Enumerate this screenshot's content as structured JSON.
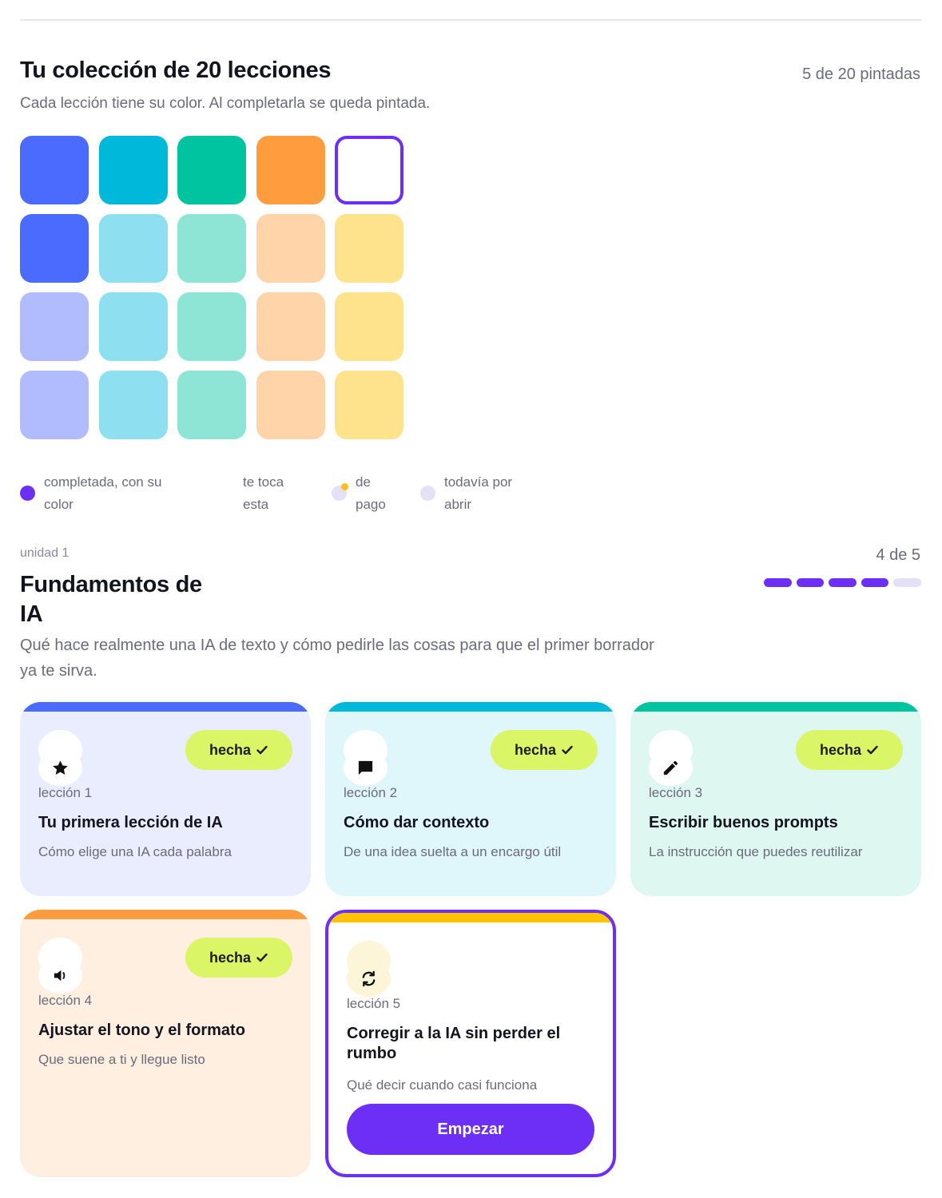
{
  "colors": {
    "accent": "#6d2ff5",
    "done_pill": "#daf566",
    "blue": "#4b6bff",
    "cyan": "#00b8d9",
    "teal": "#00c4a0",
    "orange": "#ff9c3d",
    "yellow": "#ffc300"
  },
  "collection": {
    "title": "Tu colección de 20 lecciones",
    "count": "5 de 20 pintadas",
    "subtitle": "Cada lección tiene su color. Al completarla se queda pintada.",
    "tiles": [
      {
        "state": "done",
        "color": "#4b6bff"
      },
      {
        "state": "done",
        "color": "#00b8d9"
      },
      {
        "state": "done",
        "color": "#00c4a0"
      },
      {
        "state": "done",
        "color": "#ff9c3d"
      },
      {
        "state": "current",
        "color": "#ffffff"
      },
      {
        "state": "done",
        "color": "#4b6bff"
      },
      {
        "state": "locked",
        "color": "#8ee0f0"
      },
      {
        "state": "locked",
        "color": "#8ee5d5"
      },
      {
        "state": "locked",
        "color": "#ffd4a8"
      },
      {
        "state": "locked",
        "color": "#ffe38c"
      },
      {
        "state": "locked",
        "color": "#b1bcff"
      },
      {
        "state": "locked",
        "color": "#8ee0f0"
      },
      {
        "state": "locked",
        "color": "#8ee5d5"
      },
      {
        "state": "locked",
        "color": "#ffd4a8"
      },
      {
        "state": "locked",
        "color": "#ffe38c"
      },
      {
        "state": "locked",
        "color": "#b1bcff"
      },
      {
        "state": "locked",
        "color": "#8ee0f0"
      },
      {
        "state": "locked",
        "color": "#8ee5d5"
      },
      {
        "state": "locked",
        "color": "#ffd4a8"
      },
      {
        "state": "locked",
        "color": "#ffe38c"
      }
    ],
    "legend": [
      {
        "label": "completada, con su color",
        "dot": "#6d2ff5",
        "badge": false
      },
      {
        "label": "te toca esta",
        "dot": "",
        "badge": false
      },
      {
        "label": "de pago",
        "dot": "#e4e0f5",
        "badge": true
      },
      {
        "label": "todavía por abrir",
        "dot": "#e4e0f5",
        "badge": false
      }
    ]
  },
  "unit": {
    "label": "unidad 1",
    "title": "Fundamentos de IA",
    "description": "Qué hace realmente una IA de texto y cómo pedirle las cosas para que el primer borrador ya te sirva.",
    "progress_text": "4 de 5",
    "progress": {
      "done": 4,
      "total": 5
    }
  },
  "lessons": [
    {
      "number": "lección 1",
      "title": "Tu primera lección de IA",
      "description": "Cómo elige una IA cada palabra",
      "status": "hecha",
      "icon": "star-icon",
      "bar": "#4b6bff",
      "bg": "#e9edfd"
    },
    {
      "number": "lección 2",
      "title": "Cómo dar contexto",
      "description": "De una idea suelta a un encargo útil",
      "status": "hecha",
      "icon": "chat-bubble-icon",
      "bar": "#00b8d9",
      "bg": "#dff6fa"
    },
    {
      "number": "lección 3",
      "title": "Escribir buenos prompts",
      "description": "La instrucción que puedes reutilizar",
      "status": "hecha",
      "icon": "pencil-icon",
      "bar": "#00c4a0",
      "bg": "#def7f0"
    },
    {
      "number": "lección 4",
      "title": "Ajustar el tono y el formato",
      "description": "Que suene a ti y llegue listo",
      "status": "hecha",
      "icon": "speaker-icon",
      "bar": "#ff9c3d",
      "bg": "#ffefe0"
    },
    {
      "number": "lección 5",
      "title": "Corregir a la IA sin perder el rumbo",
      "description": "Qué decir cuando casi funciona",
      "status": "",
      "icon": "refresh-icon",
      "bar": "#ffc300",
      "bg": "#ffffff",
      "action": "Empezar"
    }
  ]
}
